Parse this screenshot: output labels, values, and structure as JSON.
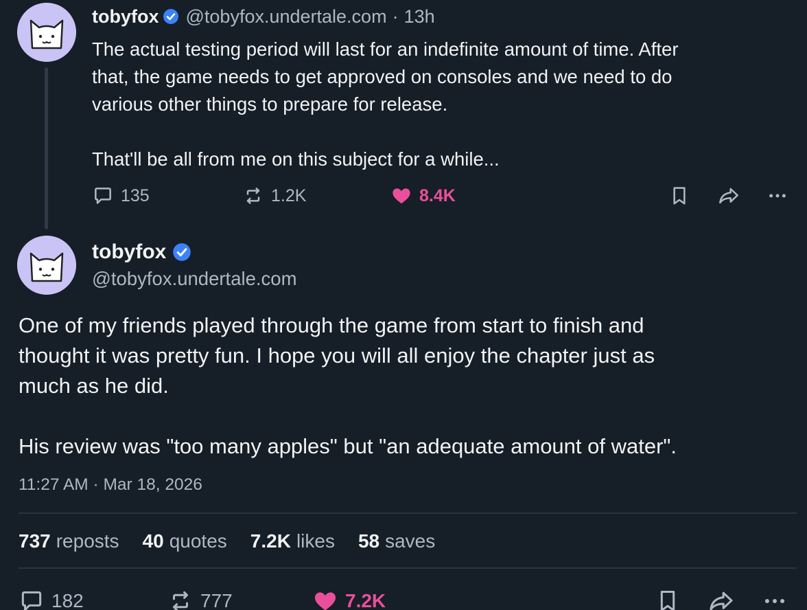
{
  "colors": {
    "background": "#161e27",
    "text": "#f1f3f5",
    "muted": "#aeb8c4",
    "accent_verified": "#3b82f6",
    "like": "#ea4f9b",
    "avatar_bg": "#c9c4f5"
  },
  "parent_post": {
    "display_name": "tobyfox",
    "handle": "@tobyfox.undertale.com",
    "separator": "·",
    "time_ago": "13h",
    "text": "The actual testing period will last for an indefinite amount of time. After\nthat, the game needs to get approved on consoles and we need to do\nvarious other things to prepare for release.\n\nThat'll be all from me on this subject for a while...",
    "replies": "135",
    "reposts": "1.2K",
    "likes": "8.4K",
    "liked": true,
    "icons": [
      "reply-icon",
      "repost-icon",
      "heart-icon",
      "bookmark-icon",
      "share-icon",
      "more-icon",
      "verified-icon"
    ]
  },
  "main_post": {
    "display_name": "tobyfox",
    "handle": "@tobyfox.undertale.com",
    "text": "One of my friends played through the game from start to finish and\nthought it was pretty fun. I hope you will all enjoy the chapter just as\nmuch as he did.\n\nHis review was \"too many apples\" but \"an adequate amount of water\".",
    "timestamp": "11:27 AM · Mar 18, 2026",
    "stats": [
      {
        "num": "737",
        "label": "reposts"
      },
      {
        "num": "40",
        "label": "quotes"
      },
      {
        "num": "7.2K",
        "label": "likes"
      },
      {
        "num": "58",
        "label": "saves"
      }
    ],
    "replies": "182",
    "reposts": "777",
    "likes": "7.2K",
    "liked": true
  }
}
